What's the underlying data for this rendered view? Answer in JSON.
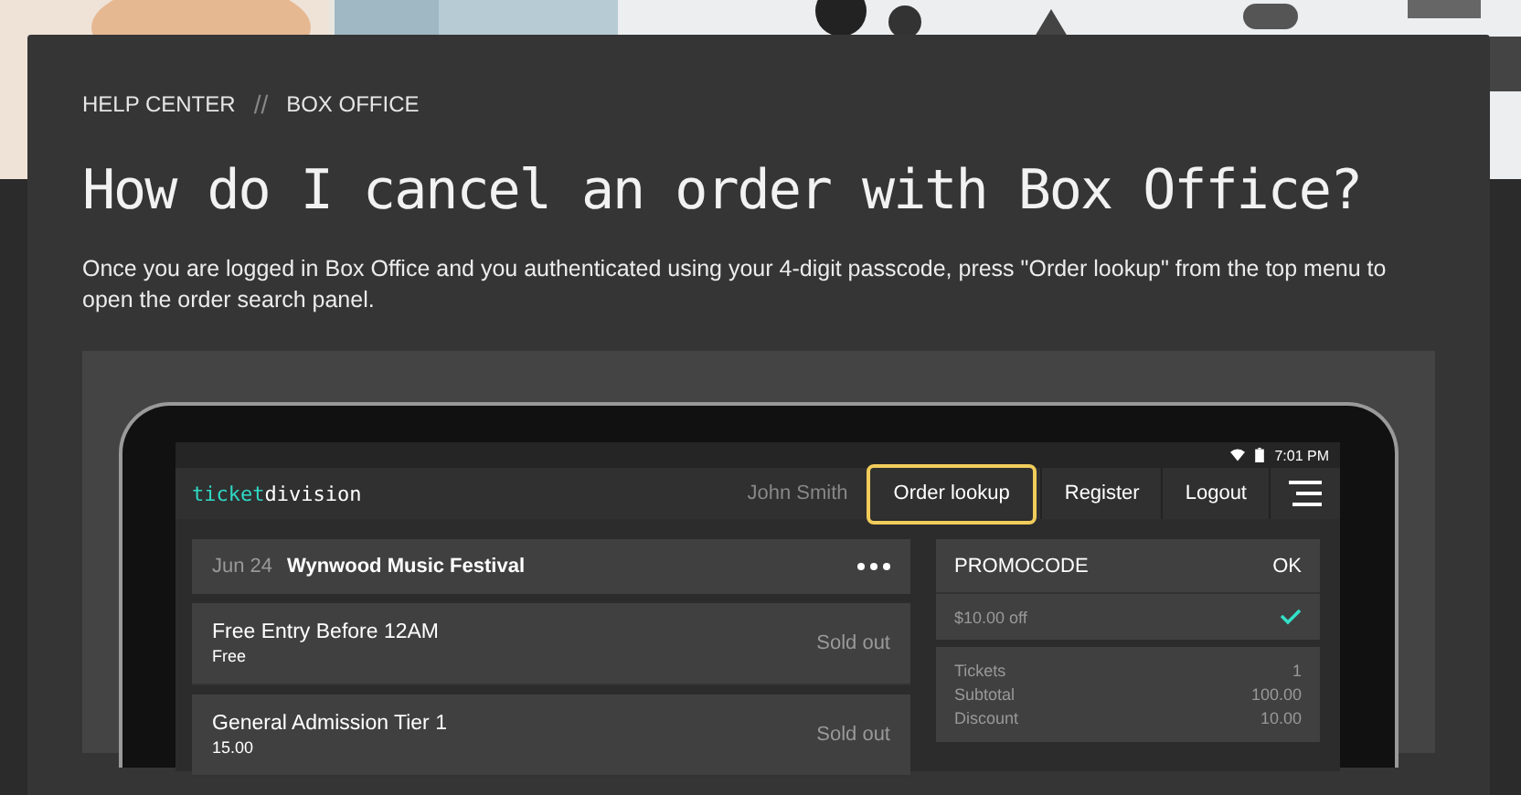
{
  "breadcrumb": {
    "items": [
      "HELP CENTER",
      "BOX OFFICE"
    ],
    "separator": "//"
  },
  "title": "How do I cancel an order with Box Office?",
  "paragraph": "Once you are logged in Box Office and you authenticated using your 4-digit passcode, press \"Order lookup\" from the top menu to open the order search panel.",
  "app": {
    "logo": {
      "first": "ticket",
      "second": "division"
    },
    "time": "7:01 PM",
    "user": "John Smith",
    "nav": [
      {
        "label": "Order lookup",
        "highlighted": true
      },
      {
        "label": "Register",
        "highlighted": false
      },
      {
        "label": "Logout",
        "highlighted": false
      }
    ],
    "event": {
      "date": "Jun 24",
      "name": "Wynwood Music Festival"
    },
    "tickets": [
      {
        "name": "Free Entry Before 12AM",
        "price": "Free",
        "status": "Sold out"
      },
      {
        "name": "General Admission Tier 1",
        "price": "15.00",
        "status": "Sold out"
      }
    ],
    "promo": {
      "label": "PROMOCODE",
      "action": "OK",
      "discount": "$10.00 off",
      "applied": true
    },
    "totals": [
      {
        "label": "Tickets",
        "value": "1"
      },
      {
        "label": "Subtotal",
        "value": "100.00"
      },
      {
        "label": "Discount",
        "value": "10.00"
      }
    ]
  }
}
